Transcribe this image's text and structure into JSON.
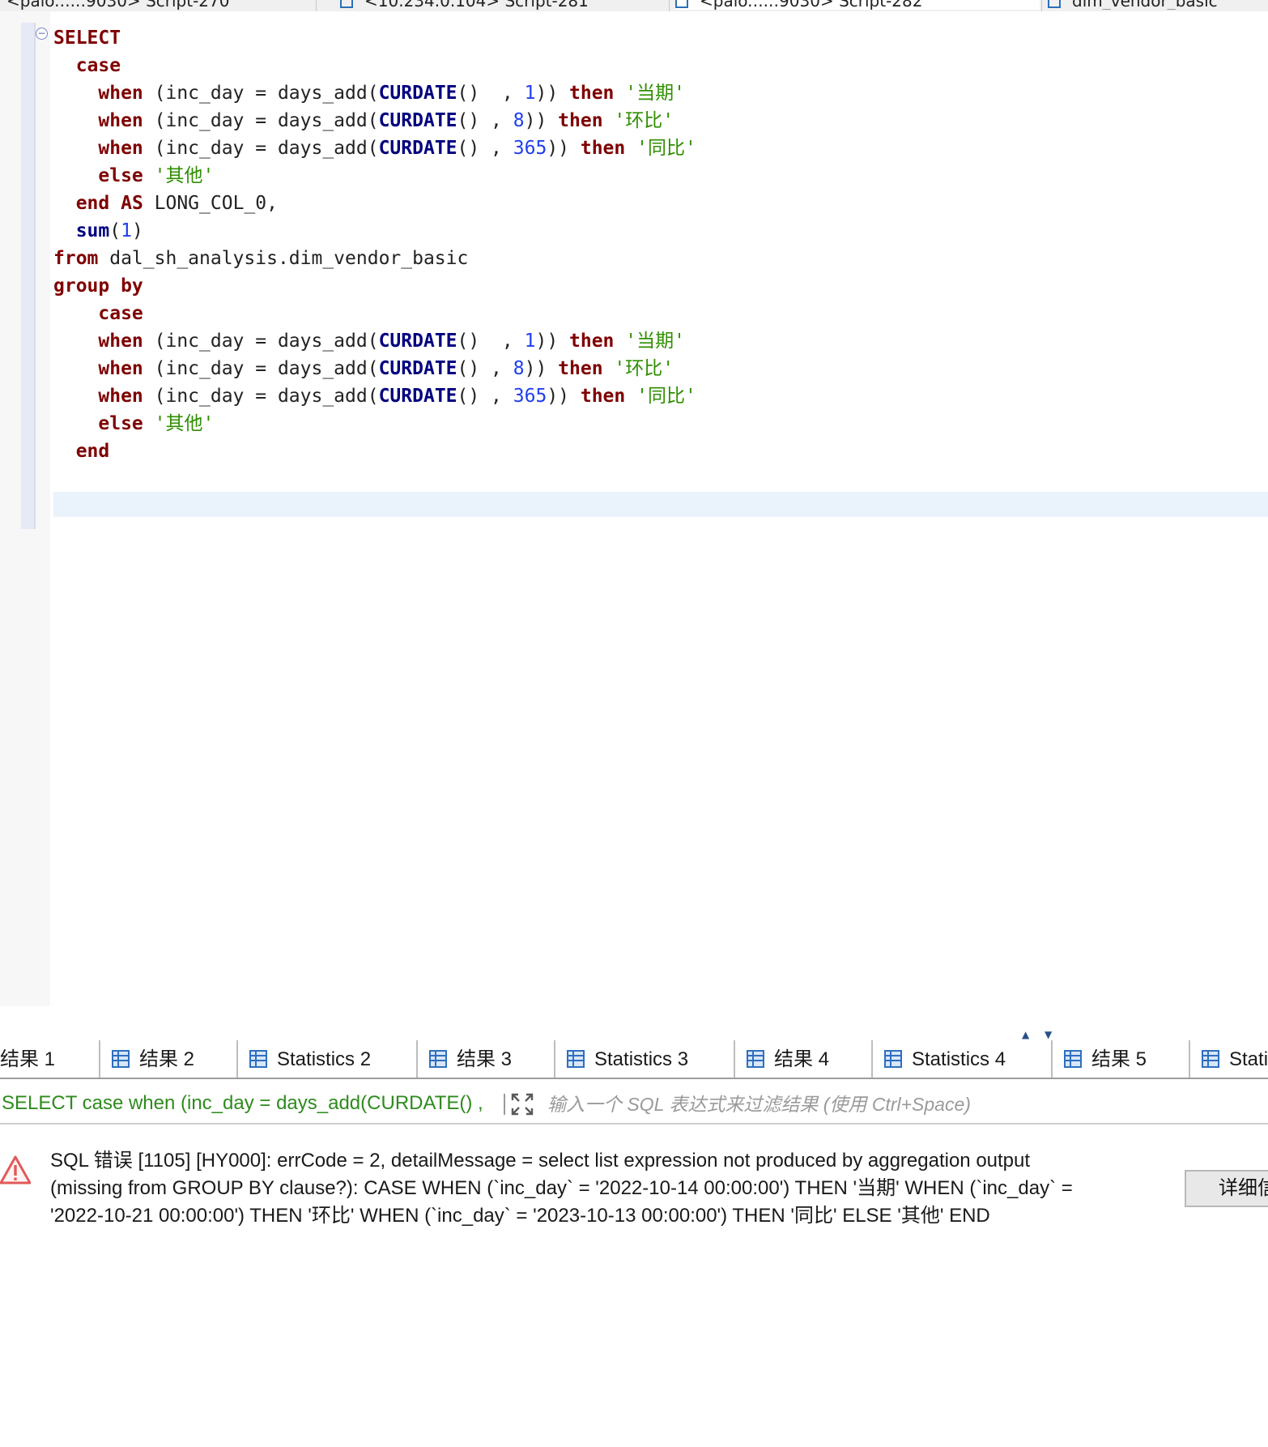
{
  "editor_tabs": [
    {
      "label": "<palo.:...:9030> Script-270"
    },
    {
      "label": "<10.234.0.104> Script-281"
    },
    {
      "label": "<palo.:...:9030> Script-282"
    },
    {
      "label": "dim_vendor_basic"
    }
  ],
  "editor": {
    "fold_icon": "collapse-icon",
    "lines": [
      [
        [
          "kw",
          "SELECT"
        ]
      ],
      [
        [
          "t",
          "  "
        ],
        [
          "kw",
          "case"
        ]
      ],
      [
        [
          "t",
          "    "
        ],
        [
          "kw",
          "when"
        ],
        [
          "t",
          " (inc_day = days_add("
        ],
        [
          "fn",
          "CURDATE"
        ],
        [
          "t",
          "()  , "
        ],
        [
          "num",
          "1"
        ],
        [
          "t",
          ")) "
        ],
        [
          "kw",
          "then"
        ],
        [
          "t",
          " "
        ],
        [
          "str",
          "'当期'"
        ]
      ],
      [
        [
          "t",
          "    "
        ],
        [
          "kw",
          "when"
        ],
        [
          "t",
          " (inc_day = days_add("
        ],
        [
          "fn",
          "CURDATE"
        ],
        [
          "t",
          "() , "
        ],
        [
          "num",
          "8"
        ],
        [
          "t",
          ")) "
        ],
        [
          "kw",
          "then"
        ],
        [
          "t",
          " "
        ],
        [
          "str",
          "'环比'"
        ]
      ],
      [
        [
          "t",
          "    "
        ],
        [
          "kw",
          "when"
        ],
        [
          "t",
          " (inc_day = days_add("
        ],
        [
          "fn",
          "CURDATE"
        ],
        [
          "t",
          "() , "
        ],
        [
          "num",
          "365"
        ],
        [
          "t",
          ")) "
        ],
        [
          "kw",
          "then"
        ],
        [
          "t",
          " "
        ],
        [
          "str",
          "'同比'"
        ]
      ],
      [
        [
          "t",
          "    "
        ],
        [
          "kw",
          "else"
        ],
        [
          "t",
          " "
        ],
        [
          "str",
          "'其他'"
        ]
      ],
      [
        [
          "t",
          "  "
        ],
        [
          "kw",
          "end AS"
        ],
        [
          "t",
          " LONG_COL_0,"
        ]
      ],
      [
        [
          "t",
          "  "
        ],
        [
          "fn",
          "sum"
        ],
        [
          "t",
          "("
        ],
        [
          "num",
          "1"
        ],
        [
          "t",
          ")"
        ]
      ],
      [
        [
          "kw",
          "from"
        ],
        [
          "t",
          " dal_sh_analysis.dim_vendor_basic"
        ]
      ],
      [
        [
          "kw",
          "group by"
        ]
      ],
      [
        [
          "t",
          "    "
        ],
        [
          "kw",
          "case"
        ]
      ],
      [
        [
          "t",
          "    "
        ],
        [
          "kw",
          "when"
        ],
        [
          "t",
          " (inc_day = days_add("
        ],
        [
          "fn",
          "CURDATE"
        ],
        [
          "t",
          "()  , "
        ],
        [
          "num",
          "1"
        ],
        [
          "t",
          ")) "
        ],
        [
          "kw",
          "then"
        ],
        [
          "t",
          " "
        ],
        [
          "str",
          "'当期'"
        ]
      ],
      [
        [
          "t",
          "    "
        ],
        [
          "kw",
          "when"
        ],
        [
          "t",
          " (inc_day = days_add("
        ],
        [
          "fn",
          "CURDATE"
        ],
        [
          "t",
          "() , "
        ],
        [
          "num",
          "8"
        ],
        [
          "t",
          ")) "
        ],
        [
          "kw",
          "then"
        ],
        [
          "t",
          " "
        ],
        [
          "str",
          "'环比'"
        ]
      ],
      [
        [
          "t",
          "    "
        ],
        [
          "kw",
          "when"
        ],
        [
          "t",
          " (inc_day = days_add("
        ],
        [
          "fn",
          "CURDATE"
        ],
        [
          "t",
          "() , "
        ],
        [
          "num",
          "365"
        ],
        [
          "t",
          ")) "
        ],
        [
          "kw",
          "then"
        ],
        [
          "t",
          " "
        ],
        [
          "str",
          "'同比'"
        ]
      ],
      [
        [
          "t",
          "    "
        ],
        [
          "kw",
          "else"
        ],
        [
          "t",
          " "
        ],
        [
          "str",
          "'其他'"
        ]
      ],
      [
        [
          "t",
          "  "
        ],
        [
          "kw",
          "end"
        ]
      ]
    ]
  },
  "result_tabs": [
    {
      "label": "结果 1",
      "icon": "grid-icon"
    },
    {
      "label": "结果 2",
      "icon": "grid-icon"
    },
    {
      "label": "Statistics 2",
      "icon": "grid-icon"
    },
    {
      "label": "结果 3",
      "icon": "grid-icon"
    },
    {
      "label": "Statistics 3",
      "icon": "grid-icon"
    },
    {
      "label": "结果 4",
      "icon": "grid-icon"
    },
    {
      "label": "Statistics 4",
      "icon": "grid-icon"
    },
    {
      "label": "结果 5",
      "icon": "grid-icon"
    },
    {
      "label": "Stati",
      "icon": "grid-icon"
    }
  ],
  "filter": {
    "query_text": "SELECT case when (inc_day = days_add(CURDATE() ,",
    "placeholder": "输入一个 SQL 表达式来过滤结果 (使用 Ctrl+Space)"
  },
  "error": {
    "message": "SQL 错误 [1105] [HY000]: errCode = 2, detailMessage = select list expression not produced by aggregation output\n(missing from GROUP BY clause?): CASE WHEN (`inc_day` = '2022-10-14 00:00:00') THEN '当期' WHEN (`inc_day` =\n'2022-10-21 00:00:00') THEN '环比' WHEN (`inc_day` = '2023-10-13 00:00:00') THEN '同比' ELSE '其他' END",
    "details_button": "详细信息",
    "icon": "warning-icon"
  },
  "colors": {
    "keyword": "#7f0000",
    "function": "#00007f",
    "number": "#1f3ff0",
    "string": "#2f8f00",
    "filter_query": "#2e8b1d",
    "error_icon": "#e05a5a",
    "tab_icon": "#2f6fc0"
  }
}
